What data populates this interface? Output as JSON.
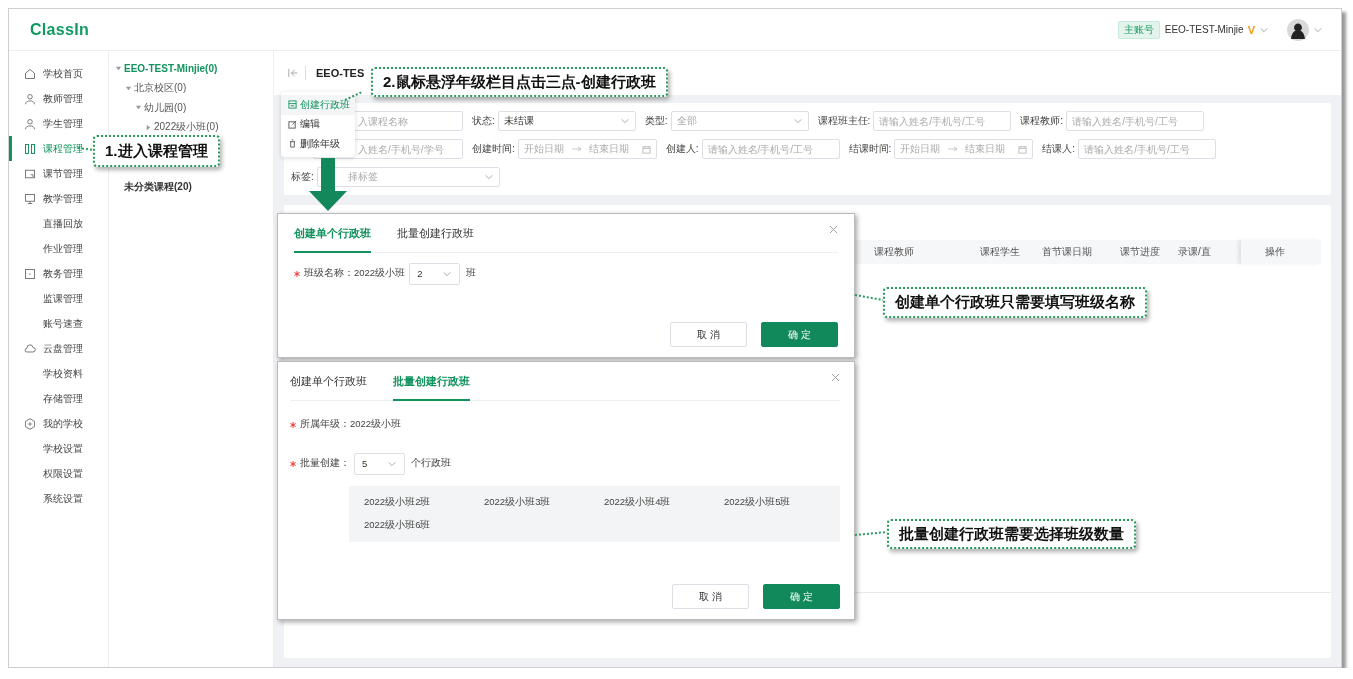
{
  "header": {
    "logo": "ClassIn",
    "account_badge": "主账号",
    "account_name": "EEO-TEST-Minjie",
    "vip_mark": "V"
  },
  "sidebar": {
    "items": [
      {
        "label": "学校首页",
        "kind": "group",
        "selected": false
      },
      {
        "label": "教师管理",
        "kind": "group",
        "selected": false
      },
      {
        "label": "学生管理",
        "kind": "group",
        "selected": false
      },
      {
        "label": "课程管理",
        "kind": "group",
        "selected": true
      },
      {
        "label": "课节管理",
        "kind": "group",
        "selected": false
      },
      {
        "label": "教学管理",
        "kind": "group",
        "selected": false
      },
      {
        "label": "直播回放",
        "kind": "sub",
        "selected": false
      },
      {
        "label": "作业管理",
        "kind": "sub",
        "selected": false
      },
      {
        "label": "教务管理",
        "kind": "group",
        "selected": false
      },
      {
        "label": "监课管理",
        "kind": "sub",
        "selected": false
      },
      {
        "label": "账号速查",
        "kind": "sub",
        "selected": false
      },
      {
        "label": "云盘管理",
        "kind": "group",
        "selected": false
      },
      {
        "label": "学校资料",
        "kind": "sub",
        "selected": false
      },
      {
        "label": "存储管理",
        "kind": "sub",
        "selected": false
      },
      {
        "label": "我的学校",
        "kind": "group",
        "selected": false
      },
      {
        "label": "学校设置",
        "kind": "sub",
        "selected": false
      },
      {
        "label": "权限设置",
        "kind": "sub",
        "selected": false
      },
      {
        "label": "系统设置",
        "kind": "sub",
        "selected": false
      }
    ]
  },
  "tree": {
    "nodes": [
      {
        "label": "EEO-TEST-Minjie(0)",
        "expanded": true,
        "selected": true,
        "children": [
          {
            "label": "北京校区(0)",
            "expanded": true,
            "selected": false,
            "children": [
              {
                "label": "幼儿园(0)",
                "expanded": true,
                "selected": false,
                "children": [
                  {
                    "label": "2022级小班(0)",
                    "expanded": false,
                    "selected": false
                  }
                ]
              }
            ]
          }
        ]
      },
      {
        "label": "未分类课程(20)",
        "selected": false
      }
    ]
  },
  "page": {
    "title": "EEO-TES"
  },
  "grade_menu": {
    "items": [
      {
        "label": "创建行政班",
        "selected": true
      },
      {
        "label": "编辑",
        "selected": false
      },
      {
        "label": "删除年级",
        "selected": false
      }
    ]
  },
  "filters": {
    "rows": [
      [
        {
          "kind": "text",
          "placeholder": "入课程名称"
        },
        {
          "label": "状态:",
          "kind": "select",
          "value": "未结课"
        },
        {
          "label": "类型:",
          "kind": "select",
          "placeholder": "全部"
        },
        {
          "label": "课程班主任:",
          "kind": "text",
          "placeholder": "请输入姓名/手机号/工号"
        },
        {
          "label": "课程教师:",
          "kind": "text",
          "placeholder": "请输入姓名/手机号/工号"
        }
      ],
      [
        {
          "kind": "text",
          "placeholder": "入姓名/手机号/学号"
        },
        {
          "label": "创建时间:",
          "kind": "range",
          "start_placeholder": "开始日期",
          "end_placeholder": "结束日期"
        },
        {
          "label": "创建人:",
          "kind": "text",
          "placeholder": "请输入姓名/手机号/工号"
        },
        {
          "label": "结课时间:",
          "kind": "range",
          "start_placeholder": "开始日期",
          "end_placeholder": "结束日期"
        },
        {
          "label": "结课人:",
          "kind": "text",
          "placeholder": "请输入姓名/手机号/工号"
        }
      ],
      [
        {
          "label": "标签:",
          "kind": "select",
          "placeholder": "择标签"
        }
      ]
    ]
  },
  "table": {
    "columns": [
      "课程教师",
      "课程学生",
      "首节课日期",
      "课节进度",
      "录课/直",
      "操作"
    ]
  },
  "dialogs": [
    {
      "tabs": [
        {
          "label": "创建单个行政班",
          "selected": true
        },
        {
          "label": "批量创建行政班",
          "selected": false
        }
      ],
      "fields": [
        {
          "kind": "select",
          "required": true,
          "label": "班级名称：",
          "prefix": "2022级小班",
          "value": "2",
          "suffix": "班"
        }
      ],
      "buttons": [
        {
          "label": "取 消",
          "kind": "secondary"
        },
        {
          "label": "确 定",
          "kind": "primary"
        }
      ]
    },
    {
      "tabs": [
        {
          "label": "创建单个行政班",
          "selected": false
        },
        {
          "label": "批量创建行政班",
          "selected": true
        }
      ],
      "fields": [
        {
          "kind": "text",
          "required": true,
          "label": "所属年级：",
          "value": "2022级小班"
        },
        {
          "kind": "select",
          "required": true,
          "label": "批量创建：",
          "value": "5",
          "suffix": "个行政班"
        }
      ],
      "preview": [
        "2022级小班2班",
        "2022级小班3班",
        "2022级小班4班",
        "2022级小班5班",
        "2022级小班6班"
      ],
      "buttons": [
        {
          "label": "取 消",
          "kind": "secondary"
        },
        {
          "label": "确 定",
          "kind": "primary"
        }
      ]
    }
  ],
  "callouts": [
    {
      "text": "1.进入课程管理"
    },
    {
      "text": "2.鼠标悬浮年级栏目点击三点-创建行政班"
    },
    {
      "text": "创建单个行政班只需要填写班级名称"
    },
    {
      "text": "批量创建行政班需要选择班级数量"
    }
  ]
}
